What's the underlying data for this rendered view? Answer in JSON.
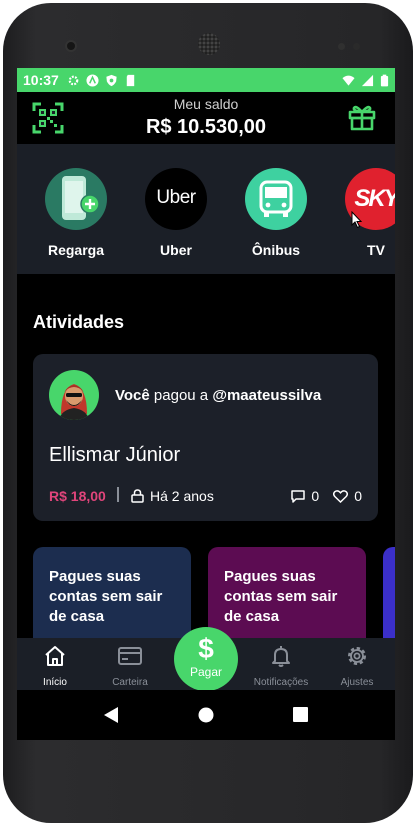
{
  "status_bar": {
    "time": "10:37"
  },
  "header": {
    "balance_label": "Meu saldo",
    "balance_value": "R$ 10.530,00"
  },
  "shortcuts": [
    {
      "label": "Regarga",
      "icon": "phone-recharge-icon",
      "color": "#2a7a63"
    },
    {
      "label": "Uber",
      "logo_text": "Uber",
      "icon": "uber-logo",
      "color": "#000000"
    },
    {
      "label": "Ônibus",
      "icon": "bus-icon",
      "color": "#3ed1a0"
    },
    {
      "label": "TV",
      "logo_text": "SKY",
      "icon": "sky-logo",
      "color": "#e0212e"
    }
  ],
  "activities": {
    "title": "Atividades",
    "items": [
      {
        "actor": "Você",
        "verb": "pagou a",
        "target": "@maateussilva",
        "description": "Ellismar Júnior",
        "amount": "R$ 18,00",
        "time_ago": "Há 2 anos",
        "comments": "0",
        "likes": "0"
      }
    ]
  },
  "promos": [
    {
      "text": "Pagues suas contas sem sair de casa",
      "color": "#1c2d4f"
    },
    {
      "text": "Pagues suas contas sem sair de casa",
      "color": "#5c0c52"
    }
  ],
  "bottom_nav": {
    "items": [
      {
        "label": "Início",
        "icon": "home-icon"
      },
      {
        "label": "Carteira",
        "icon": "wallet-icon"
      },
      {
        "label": "Notificações",
        "icon": "bell-icon"
      },
      {
        "label": "Ajustes",
        "icon": "gear-icon"
      }
    ],
    "pay": {
      "symbol": "$",
      "label": "Pagar"
    }
  },
  "colors": {
    "accent": "#48d66b",
    "amount": "#e0457b",
    "card": "#1c2029",
    "panel": "#1b1f27"
  }
}
